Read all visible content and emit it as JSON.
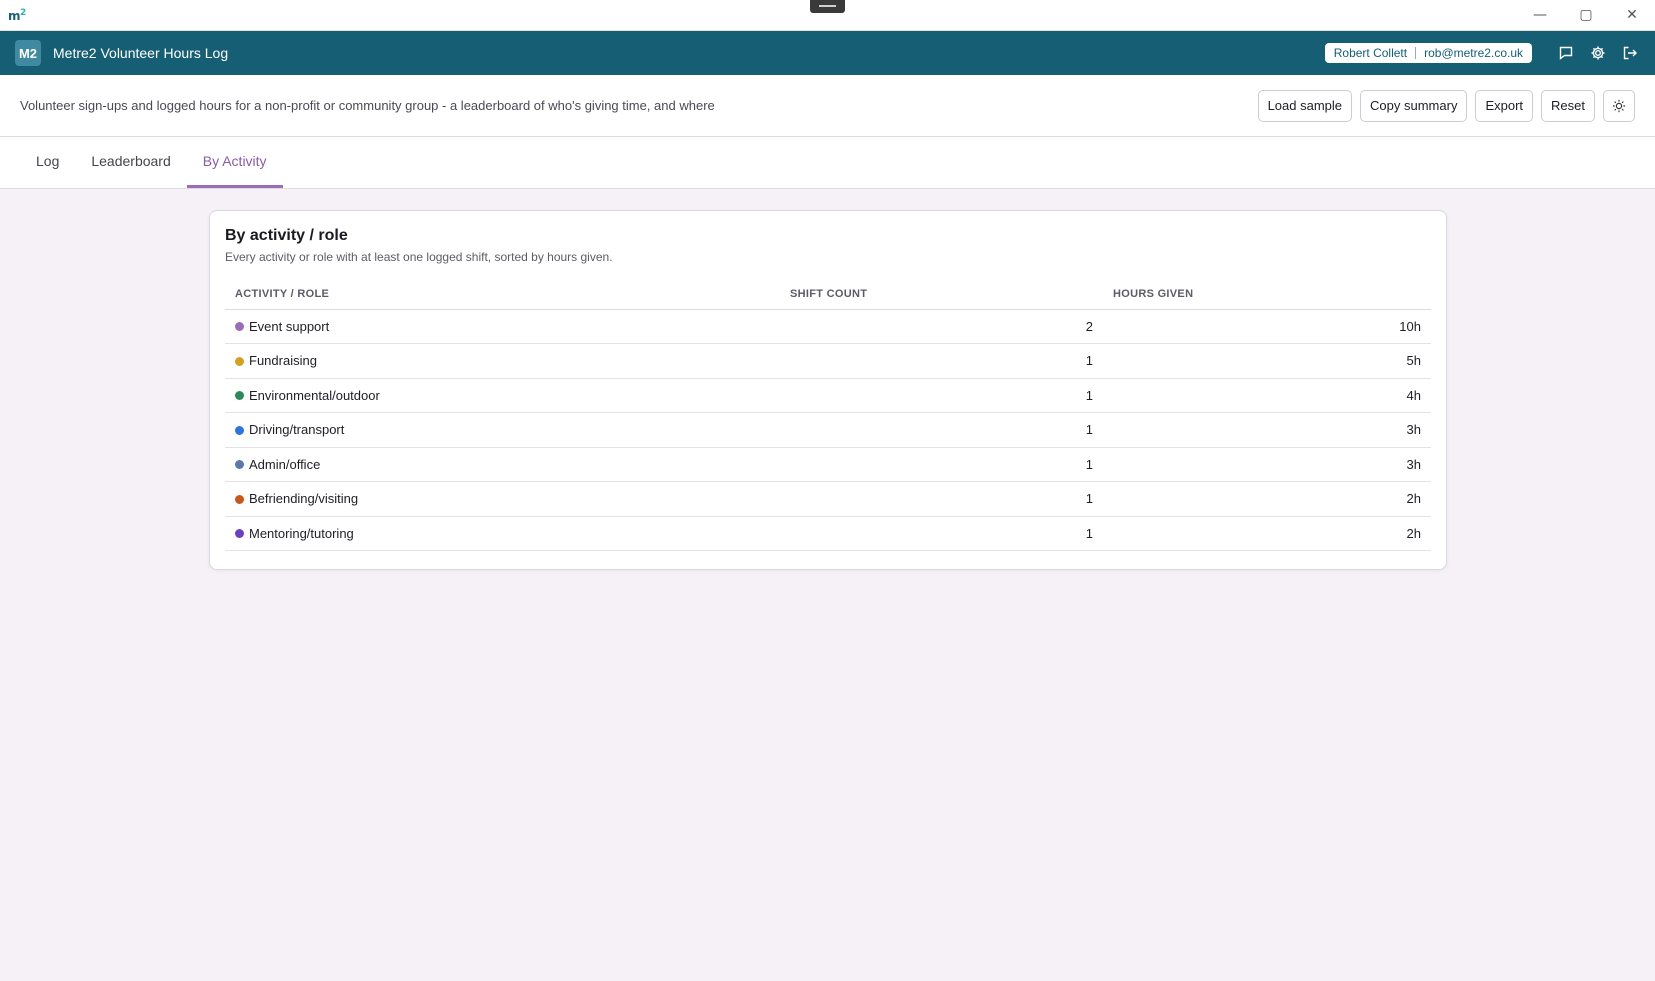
{
  "window": {
    "logo_main": "m",
    "logo_sup": "2",
    "minimize": "—",
    "maximize": "▢",
    "close": "✕"
  },
  "header": {
    "badge": "M2",
    "title": "Metre2 Volunteer Hours Log",
    "user_name": "Robert Collett",
    "user_email": "rob@metre2.co.uk",
    "icons": [
      "chat-icon",
      "gear-icon",
      "logout-icon"
    ]
  },
  "toolbar": {
    "description": "Volunteer sign-ups and logged hours for a non-profit or community group - a leaderboard of who's giving time, and where",
    "load_sample": "Load sample",
    "copy_summary": "Copy summary",
    "export": "Export",
    "reset": "Reset",
    "theme_icon": "sun-icon"
  },
  "tabs": [
    {
      "label": "Log",
      "active": false
    },
    {
      "label": "Leaderboard",
      "active": false
    },
    {
      "label": "By Activity",
      "active": true
    }
  ],
  "panel": {
    "title": "By activity / role",
    "subtitle": "Every activity or role with at least one logged shift, sorted by hours given.",
    "columns": [
      "ACTIVITY / ROLE",
      "SHIFT COUNT",
      "HOURS GIVEN"
    ],
    "rows": [
      {
        "activity": "Event support",
        "color": "#9b6cb8",
        "shifts": "2",
        "hours": "10h"
      },
      {
        "activity": "Fundraising",
        "color": "#d4a021",
        "shifts": "1",
        "hours": "5h"
      },
      {
        "activity": "Environmental/outdoor",
        "color": "#2b8a57",
        "shifts": "1",
        "hours": "4h"
      },
      {
        "activity": "Driving/transport",
        "color": "#2e73de",
        "shifts": "1",
        "hours": "3h"
      },
      {
        "activity": "Admin/office",
        "color": "#5a7aa6",
        "shifts": "1",
        "hours": "3h"
      },
      {
        "activity": "Befriending/visiting",
        "color": "#c8561a",
        "shifts": "1",
        "hours": "2h"
      },
      {
        "activity": "Mentoring/tutoring",
        "color": "#6a3fc2",
        "shifts": "1",
        "hours": "2h"
      }
    ]
  }
}
